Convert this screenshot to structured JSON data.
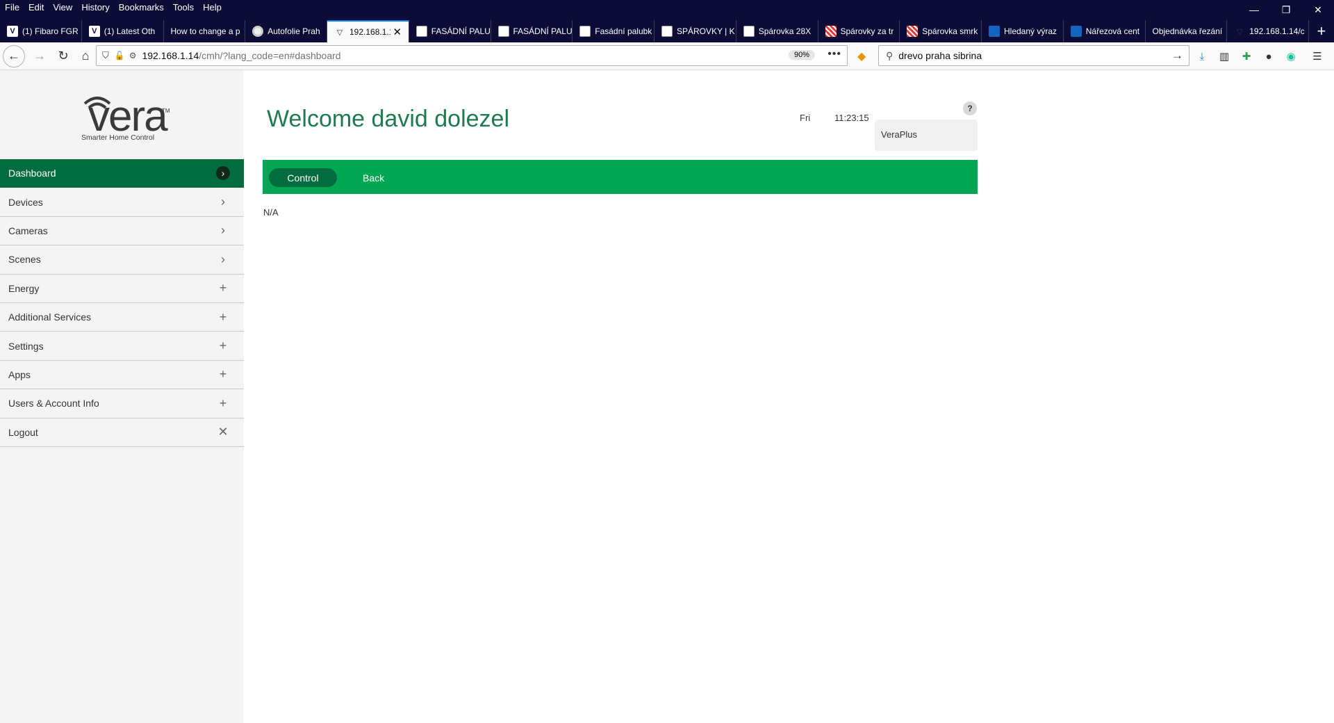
{
  "browser": {
    "menu": [
      "File",
      "Edit",
      "View",
      "History",
      "Bookmarks",
      "Tools",
      "Help"
    ],
    "window_controls": {
      "minimize": "—",
      "restore": "❐",
      "close": "✕"
    },
    "tabs": [
      {
        "title": "(1) Fibaro FGR",
        "icon": "v-icon",
        "glyph": "V"
      },
      {
        "title": "(1) Latest Oth",
        "icon": "v-icon",
        "glyph": "V"
      },
      {
        "title": "How to change a p",
        "icon": "none",
        "glyph": ""
      },
      {
        "title": "Autofolie Prah",
        "icon": "circle-icon",
        "glyph": ""
      },
      {
        "title": "192.168.1.1",
        "icon": "vera-icon",
        "glyph": "▽",
        "active": true
      },
      {
        "title": "FASÁDNÍ PALU",
        "icon": "page-icon",
        "glyph": ""
      },
      {
        "title": "FASÁDNÍ PALU",
        "icon": "page-icon",
        "glyph": ""
      },
      {
        "title": "Fasádní palubk",
        "icon": "page-icon",
        "glyph": ""
      },
      {
        "title": "SPÁROVKY | K",
        "icon": "page-icon",
        "glyph": ""
      },
      {
        "title": "Spárovka 28X",
        "icon": "page-icon",
        "glyph": ""
      },
      {
        "title": "Spárovky za tr",
        "icon": "striped-icon",
        "glyph": ""
      },
      {
        "title": "Spárovka smrk",
        "icon": "striped-icon",
        "glyph": ""
      },
      {
        "title": "Hledaný výraz",
        "icon": "blue-icon",
        "glyph": ""
      },
      {
        "title": "Nářezová cent",
        "icon": "blue-icon",
        "glyph": ""
      },
      {
        "title": "Objednávka řezání",
        "icon": "none",
        "glyph": ""
      },
      {
        "title": "192.168.1.14/c",
        "icon": "vera-icon",
        "glyph": "▽"
      }
    ],
    "new_tab": "+",
    "address": {
      "host": "192.168.1.14",
      "path": "/cmh/?lang_code=en#dashboard",
      "zoom": "90%",
      "more": "•••"
    },
    "search": {
      "value": "drevo praha sibrina",
      "go": "→"
    },
    "nav_glyphs": {
      "back": "←",
      "forward": "→",
      "reload": "↻",
      "home": "⌂"
    }
  },
  "sidebar": {
    "logo": {
      "word": "vera",
      "tm": "TM",
      "tagline": "Smarter Home Control"
    },
    "items": [
      {
        "label": "Dashboard",
        "symbol": "›",
        "active": true
      },
      {
        "label": "Devices",
        "symbol": "›"
      },
      {
        "label": "Cameras",
        "symbol": "›"
      },
      {
        "label": "Scenes",
        "symbol": "›"
      },
      {
        "label": "Energy",
        "symbol": "+"
      },
      {
        "label": "Additional Services",
        "symbol": "+"
      },
      {
        "label": "Settings",
        "symbol": "+"
      },
      {
        "label": "Apps",
        "symbol": "+"
      },
      {
        "label": "Users & Account Info",
        "symbol": "+"
      },
      {
        "label": "Logout",
        "symbol": "✕"
      }
    ]
  },
  "main": {
    "welcome": "Welcome david dolezel",
    "day": "Fri",
    "time": "11:23:15",
    "help": "?",
    "unit": "VeraPlus",
    "buttons": {
      "control": "Control",
      "back": "Back"
    },
    "content": "N/A"
  },
  "colors": {
    "accent": "#00a651",
    "accent_dark": "#006c3f",
    "title": "#1e7a4f",
    "chrome": "#0c0c37"
  }
}
